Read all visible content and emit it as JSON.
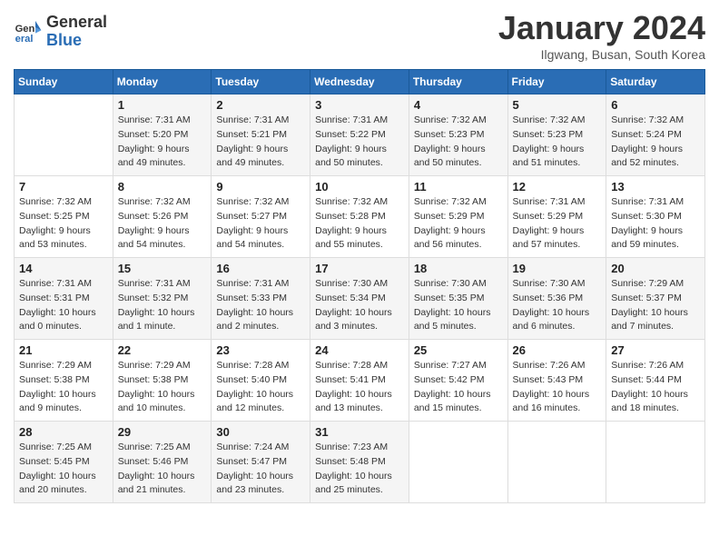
{
  "header": {
    "logo_line1": "General",
    "logo_line2": "Blue",
    "title": "January 2024",
    "subtitle": "Ilgwang, Busan, South Korea"
  },
  "days_of_week": [
    "Sunday",
    "Monday",
    "Tuesday",
    "Wednesday",
    "Thursday",
    "Friday",
    "Saturday"
  ],
  "weeks": [
    [
      {
        "day": "",
        "info": ""
      },
      {
        "day": "1",
        "info": "Sunrise: 7:31 AM\nSunset: 5:20 PM\nDaylight: 9 hours\nand 49 minutes."
      },
      {
        "day": "2",
        "info": "Sunrise: 7:31 AM\nSunset: 5:21 PM\nDaylight: 9 hours\nand 49 minutes."
      },
      {
        "day": "3",
        "info": "Sunrise: 7:31 AM\nSunset: 5:22 PM\nDaylight: 9 hours\nand 50 minutes."
      },
      {
        "day": "4",
        "info": "Sunrise: 7:32 AM\nSunset: 5:23 PM\nDaylight: 9 hours\nand 50 minutes."
      },
      {
        "day": "5",
        "info": "Sunrise: 7:32 AM\nSunset: 5:23 PM\nDaylight: 9 hours\nand 51 minutes."
      },
      {
        "day": "6",
        "info": "Sunrise: 7:32 AM\nSunset: 5:24 PM\nDaylight: 9 hours\nand 52 minutes."
      }
    ],
    [
      {
        "day": "7",
        "info": "Sunrise: 7:32 AM\nSunset: 5:25 PM\nDaylight: 9 hours\nand 53 minutes."
      },
      {
        "day": "8",
        "info": "Sunrise: 7:32 AM\nSunset: 5:26 PM\nDaylight: 9 hours\nand 54 minutes."
      },
      {
        "day": "9",
        "info": "Sunrise: 7:32 AM\nSunset: 5:27 PM\nDaylight: 9 hours\nand 54 minutes."
      },
      {
        "day": "10",
        "info": "Sunrise: 7:32 AM\nSunset: 5:28 PM\nDaylight: 9 hours\nand 55 minutes."
      },
      {
        "day": "11",
        "info": "Sunrise: 7:32 AM\nSunset: 5:29 PM\nDaylight: 9 hours\nand 56 minutes."
      },
      {
        "day": "12",
        "info": "Sunrise: 7:31 AM\nSunset: 5:29 PM\nDaylight: 9 hours\nand 57 minutes."
      },
      {
        "day": "13",
        "info": "Sunrise: 7:31 AM\nSunset: 5:30 PM\nDaylight: 9 hours\nand 59 minutes."
      }
    ],
    [
      {
        "day": "14",
        "info": "Sunrise: 7:31 AM\nSunset: 5:31 PM\nDaylight: 10 hours\nand 0 minutes."
      },
      {
        "day": "15",
        "info": "Sunrise: 7:31 AM\nSunset: 5:32 PM\nDaylight: 10 hours\nand 1 minute."
      },
      {
        "day": "16",
        "info": "Sunrise: 7:31 AM\nSunset: 5:33 PM\nDaylight: 10 hours\nand 2 minutes."
      },
      {
        "day": "17",
        "info": "Sunrise: 7:30 AM\nSunset: 5:34 PM\nDaylight: 10 hours\nand 3 minutes."
      },
      {
        "day": "18",
        "info": "Sunrise: 7:30 AM\nSunset: 5:35 PM\nDaylight: 10 hours\nand 5 minutes."
      },
      {
        "day": "19",
        "info": "Sunrise: 7:30 AM\nSunset: 5:36 PM\nDaylight: 10 hours\nand 6 minutes."
      },
      {
        "day": "20",
        "info": "Sunrise: 7:29 AM\nSunset: 5:37 PM\nDaylight: 10 hours\nand 7 minutes."
      }
    ],
    [
      {
        "day": "21",
        "info": "Sunrise: 7:29 AM\nSunset: 5:38 PM\nDaylight: 10 hours\nand 9 minutes."
      },
      {
        "day": "22",
        "info": "Sunrise: 7:29 AM\nSunset: 5:38 PM\nDaylight: 10 hours\nand 10 minutes."
      },
      {
        "day": "23",
        "info": "Sunrise: 7:28 AM\nSunset: 5:40 PM\nDaylight: 10 hours\nand 12 minutes."
      },
      {
        "day": "24",
        "info": "Sunrise: 7:28 AM\nSunset: 5:41 PM\nDaylight: 10 hours\nand 13 minutes."
      },
      {
        "day": "25",
        "info": "Sunrise: 7:27 AM\nSunset: 5:42 PM\nDaylight: 10 hours\nand 15 minutes."
      },
      {
        "day": "26",
        "info": "Sunrise: 7:26 AM\nSunset: 5:43 PM\nDaylight: 10 hours\nand 16 minutes."
      },
      {
        "day": "27",
        "info": "Sunrise: 7:26 AM\nSunset: 5:44 PM\nDaylight: 10 hours\nand 18 minutes."
      }
    ],
    [
      {
        "day": "28",
        "info": "Sunrise: 7:25 AM\nSunset: 5:45 PM\nDaylight: 10 hours\nand 20 minutes."
      },
      {
        "day": "29",
        "info": "Sunrise: 7:25 AM\nSunset: 5:46 PM\nDaylight: 10 hours\nand 21 minutes."
      },
      {
        "day": "30",
        "info": "Sunrise: 7:24 AM\nSunset: 5:47 PM\nDaylight: 10 hours\nand 23 minutes."
      },
      {
        "day": "31",
        "info": "Sunrise: 7:23 AM\nSunset: 5:48 PM\nDaylight: 10 hours\nand 25 minutes."
      },
      {
        "day": "",
        "info": ""
      },
      {
        "day": "",
        "info": ""
      },
      {
        "day": "",
        "info": ""
      }
    ]
  ]
}
